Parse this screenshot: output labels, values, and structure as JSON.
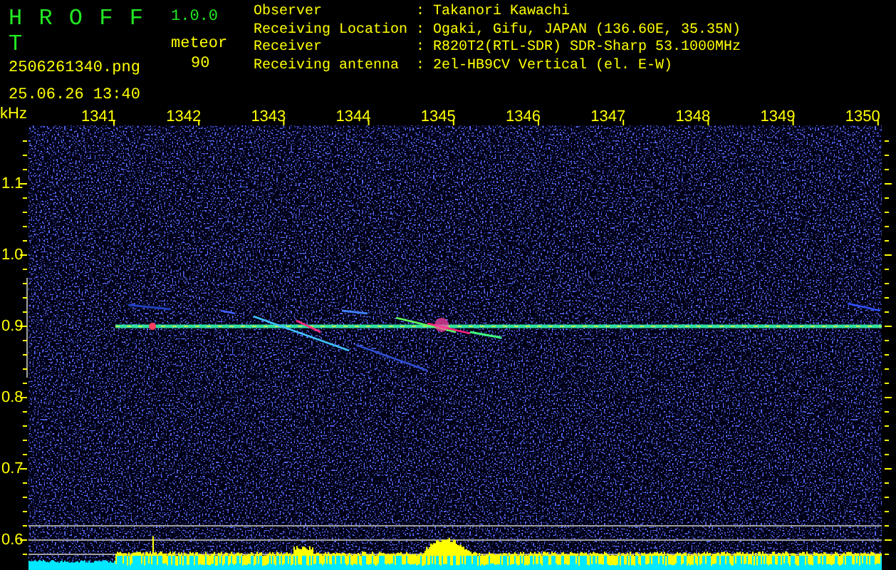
{
  "header": {
    "app_name": "H R O F F T",
    "version": "1.0.0",
    "file_name": "2506261340.png",
    "timestamp": "25.06.26 13:40",
    "category": "meteor",
    "count": "90"
  },
  "station_info": [
    {
      "label": "Observer",
      "value": ": Takanori Kawachi"
    },
    {
      "label": "Receiving Location",
      "value": ": Ogaki, Gifu, JAPAN (136.60E, 35.35N)"
    },
    {
      "label": "Receiver",
      "value": ": R820T2(RTL-SDR) SDR-Sharp 53.1000MHz"
    },
    {
      "label": "Receiving antenna",
      "value": ": 2el-HB9CV Vertical (el. E-W)"
    }
  ],
  "spectrogram": {
    "y_unit": "kHz",
    "x_labels": [
      "1341",
      "1342",
      "1343",
      "1344",
      "1345",
      "1346",
      "1347",
      "1348",
      "1349",
      "1350"
    ],
    "y_labels": [
      "1.1",
      "1.0",
      "0.9",
      "0.8",
      "0.7",
      "0.6"
    ]
  }
}
